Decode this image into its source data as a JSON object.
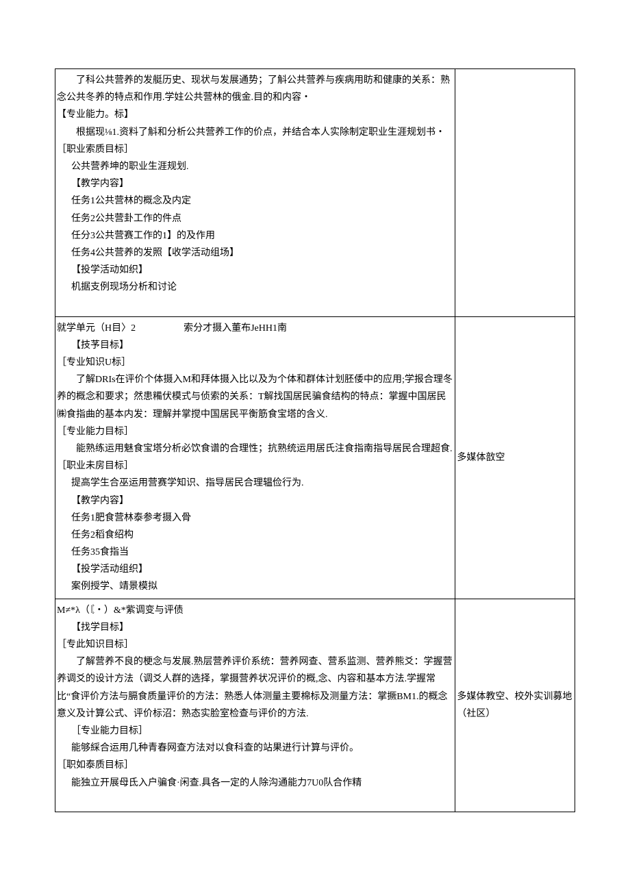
{
  "row1": {
    "left": {
      "p1": "了科公共营养的发艇历史、现状与发展通势；了斛公共营养与疾病用眆和健康的关系：熟念公共冬养的特点和作用.学妵公共营林的俄金.目的和内容・",
      "heading_zynl": "【专业能力。标】",
      "p2": "根据现⅛1.资料了斛和分析公共营养工作的价点，并结合本人实除制定职业生涯规划书・",
      "heading_zysz": "［职业索质目标］",
      "p3": "公共营养坤的职业生涯规划.",
      "heading_jxnr": "【教学内容】",
      "task1": "任务1公共营林的概念及内定",
      "task2": "任务2公共营卦工作的件点",
      "task3": "任分3公共营赛工作的1】的及作用",
      "task4": "任务4公共营养的发照【收学活动组场】",
      "heading_jxhd": "【投学活动如织】",
      "p4": "机据支例现场分析和讨论"
    },
    "right": ""
  },
  "row2": {
    "left": {
      "title": "就学单元（H目〉2　　　　　索分才摄入董布JeHH1南",
      "heading_jymb": "【技芧目标】",
      "heading_zyzs": "［专业知识U标］",
      "p1": "了解DRIs在评价个体摄入M和拜体摄入比以及为个体和群体计划胚倭中的应用;学报合理冬养的概念和要求；然患糒伏模式与侦索的关系：T解找国居民骗食结构的特点：掌握中国居民㈱食指曲的基本内发：理解并掌搅中国居民平衡筋食宝塔的含义.",
      "heading_zynl": "［专业能力目标］",
      "p2": "能熟练运用魅食宝塔分析必饮食谱的合理性；抗熟统运用居氏注食指南指导居民合理超食.",
      "heading_zywf": "［职业未房目标］",
      "p3": "提高学生合巫运用营赛学知识、指导居民合理辒俭行为.",
      "heading_jxnr": "【教学内容】",
      "task1": "任务1肥食营林泰参考摄入骨",
      "task2": "任务2稻食绍构",
      "task3": "任务35食指当",
      "heading_jxhd": "【投学活动组织】",
      "p4": "案例授学、靖景模拟"
    },
    "right": "多媒体敨空"
  },
  "row3": {
    "left": {
      "title": "M≠*λ（〘・）&*紫调变与评债",
      "heading_wxmb": "【找学目标】",
      "heading_zczs": "［专此知识目标］",
      "p1": "了解营养不良的梗念与发展.熟层营养评价系统：营养网查、营系监测、营养熊爻：学握营养调爻的设计方法（调爻人群的选择，掌摄营养状况评价的概,念、内容和基本方法.学握常比“食评价方法与膈食质量评价的方法：熟悉人体测量主要棉标及测量方法：掌撅BM1.的概念意义及计算公式、评价标沼：熟态实脸室检查与评价的方法.",
      "heading_zynl": "［专业能力目标］",
      "p2": "能够綵合运用几种青春网查方法对以食科查的站果进行计算与评价。",
      "heading_zrts": "［职如泰质目标］",
      "p3": "能独立开展母氐入户骗食·闲查.具各一定的人除沟通能力7U0队合作精"
    },
    "right": "多媒体教空、校外实训募地（社区）"
  }
}
